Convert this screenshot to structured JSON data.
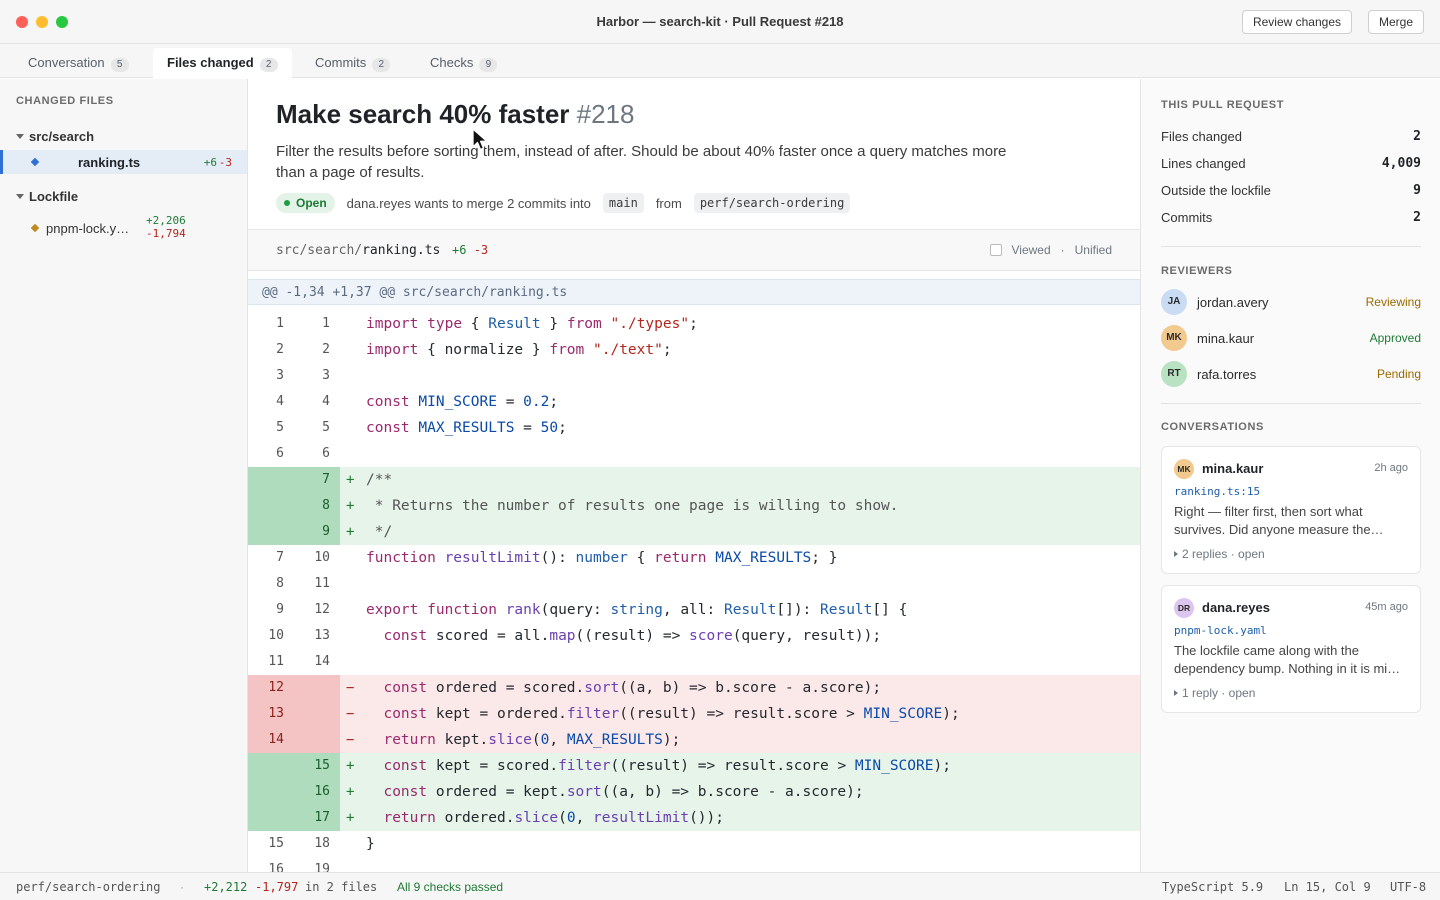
{
  "window": {
    "title": "Harbor — search-kit · Pull Request #218",
    "review_label": "Review changes",
    "merge_label": "Merge"
  },
  "tabs": [
    {
      "label": "Conversation",
      "count": "5"
    },
    {
      "label": "Files changed",
      "count": "2"
    },
    {
      "label": "Commits",
      "count": "2"
    },
    {
      "label": "Checks",
      "count": "9"
    }
  ],
  "sidebar": {
    "heading": "CHANGED FILES",
    "folders": [
      {
        "name": "src/search",
        "files": [
          {
            "name": "ranking.ts",
            "add": "+6",
            "del": "-3"
          }
        ]
      },
      {
        "name": "Lockfile",
        "files": [
          {
            "name": "pnpm-lock.y…",
            "add": "+2,206",
            "del": "-1,794"
          }
        ]
      }
    ]
  },
  "pr": {
    "title": "Make search 40% faster",
    "number": "#218",
    "description": "Filter the results before sorting them, instead of after. Should be about 40% faster once a query matches more than a page of results.",
    "status": "Open",
    "merge_text": "dana.reyes wants to merge 2 commits into",
    "base": "main",
    "from_word": "from",
    "head": "perf/search-ordering"
  },
  "file": {
    "dir": "src/search/",
    "name": "ranking.ts",
    "add": "+6",
    "del": "-3",
    "viewed_label": "Viewed",
    "sep": "·",
    "mode": "Unified",
    "hunk": "@@ -1,34 +1,37 @@ src/search/ranking.ts"
  },
  "diff": [
    {
      "t": "ctx",
      "o": "1",
      "n": "1",
      "code": "import type { Result } from \"./types\";"
    },
    {
      "t": "ctx",
      "o": "2",
      "n": "2",
      "code": "import { normalize } from \"./text\";"
    },
    {
      "t": "ctx",
      "o": "3",
      "n": "3",
      "code": ""
    },
    {
      "t": "ctx",
      "o": "4",
      "n": "4",
      "code": "const MIN_SCORE = 0.2;"
    },
    {
      "t": "ctx",
      "o": "5",
      "n": "5",
      "code": "const MAX_RESULTS = 50;"
    },
    {
      "t": "ctx",
      "o": "6",
      "n": "6",
      "code": ""
    },
    {
      "t": "add",
      "o": "",
      "n": "7",
      "code": "/**"
    },
    {
      "t": "add",
      "o": "",
      "n": "8",
      "code": " * Returns the number of results one page is willing to show."
    },
    {
      "t": "add",
      "o": "",
      "n": "9",
      "code": " */"
    },
    {
      "t": "ctx",
      "o": "7",
      "n": "10",
      "code": "function resultLimit(): number { return MAX_RESULTS; }"
    },
    {
      "t": "ctx",
      "o": "8",
      "n": "11",
      "code": ""
    },
    {
      "t": "ctx",
      "o": "9",
      "n": "12",
      "code": "export function rank(query: string, all: Result[]): Result[] {"
    },
    {
      "t": "ctx",
      "o": "10",
      "n": "13",
      "code": "  const scored = all.map((result) => score(query, result));"
    },
    {
      "t": "ctx",
      "o": "11",
      "n": "14",
      "code": ""
    },
    {
      "t": "del",
      "o": "12",
      "n": "",
      "code": "  const ordered = scored.sort((a, b) => b.score - a.score);"
    },
    {
      "t": "del",
      "o": "13",
      "n": "",
      "code": "  const kept = ordered.filter((result) => result.score > MIN_SCORE);"
    },
    {
      "t": "del",
      "o": "14",
      "n": "",
      "code": "  return kept.slice(0, MAX_RESULTS);"
    },
    {
      "t": "add",
      "o": "",
      "n": "15",
      "code": "  const kept = scored.filter((result) => result.score > MIN_SCORE);"
    },
    {
      "t": "add",
      "o": "",
      "n": "16",
      "code": "  const ordered = kept.sort((a, b) => b.score - a.score);"
    },
    {
      "t": "add",
      "o": "",
      "n": "17",
      "code": "  return ordered.slice(0, resultLimit());"
    },
    {
      "t": "ctx",
      "o": "15",
      "n": "18",
      "code": "}"
    },
    {
      "t": "ctx",
      "o": "16",
      "n": "19",
      "code": ""
    }
  ],
  "summary": {
    "heading": "THIS PULL REQUEST",
    "rows": [
      {
        "label": "Files changed",
        "value": "2"
      },
      {
        "label": "Lines changed",
        "value": "4,009"
      },
      {
        "label": "Outside the lockfile",
        "value": "9"
      },
      {
        "label": "Commits",
        "value": "2"
      }
    ]
  },
  "reviewers": {
    "heading": "REVIEWERS",
    "items": [
      {
        "initials": "JA",
        "name": "jordan.avery",
        "status": "Reviewing",
        "color": "#c9dcf3",
        "status_color": "#9a6a00"
      },
      {
        "initials": "MK",
        "name": "mina.kaur",
        "status": "Approved",
        "color": "#f2c98f",
        "status_color": "#1f7a35"
      },
      {
        "initials": "RT",
        "name": "rafa.torres",
        "status": "Pending",
        "color": "#b9e2c3",
        "status_color": "#9a6a00"
      }
    ]
  },
  "conversations": {
    "heading": "CONVERSATIONS",
    "items": [
      {
        "initials": "MK",
        "author": "mina.kaur",
        "time": "2h ago",
        "file": "ranking.ts:15",
        "body": "Right — filter first, then sort what survives. Did anyone measure the…",
        "footer": "2 replies · open",
        "color": "#f2c98f"
      },
      {
        "initials": "DR",
        "author": "dana.reyes",
        "time": "45m ago",
        "file": "pnpm-lock.yaml",
        "body": "The lockfile came along with the dependency bump. Nothing in it is mi…",
        "footer": "1 reply · open",
        "color": "#dcc6ef"
      }
    ]
  },
  "statusbar": {
    "branch": "perf/search-ordering",
    "sep": "·",
    "add": "+2,212",
    "del": "-1,797",
    "files": "in 2 files",
    "checks": "All 9 checks passed",
    "language": "TypeScript 5.9",
    "position": "Ln 15, Col 9",
    "encoding": "UTF-8"
  }
}
